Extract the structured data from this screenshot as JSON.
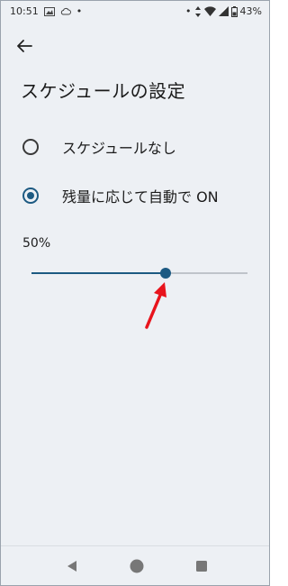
{
  "status_bar": {
    "time": "10:51",
    "battery": "43%",
    "dot": "•",
    "icons": [
      "image-icon",
      "cloud-icon",
      "bell-dot-icon",
      "data-arrows-icon",
      "wifi-icon",
      "signal-icon",
      "battery-icon"
    ]
  },
  "header": {
    "back_icon": "arrow-left-icon",
    "title": "スケジュールの設定"
  },
  "options": [
    {
      "label": "スケジュールなし",
      "selected": false
    },
    {
      "label": "残量に応じて自動で ON",
      "selected": true
    }
  ],
  "slider": {
    "value_label": "50%",
    "value": 0.62
  },
  "annotation": {
    "color": "#e8141c",
    "icon": "red-arrow-icon"
  },
  "colors": {
    "accent": "#1d5a82",
    "background": "#edf0f4",
    "track": "#bfc4ca"
  },
  "nav_bar": {
    "icons": [
      "back-triangle-icon",
      "home-circle-icon",
      "recents-square-icon"
    ]
  }
}
